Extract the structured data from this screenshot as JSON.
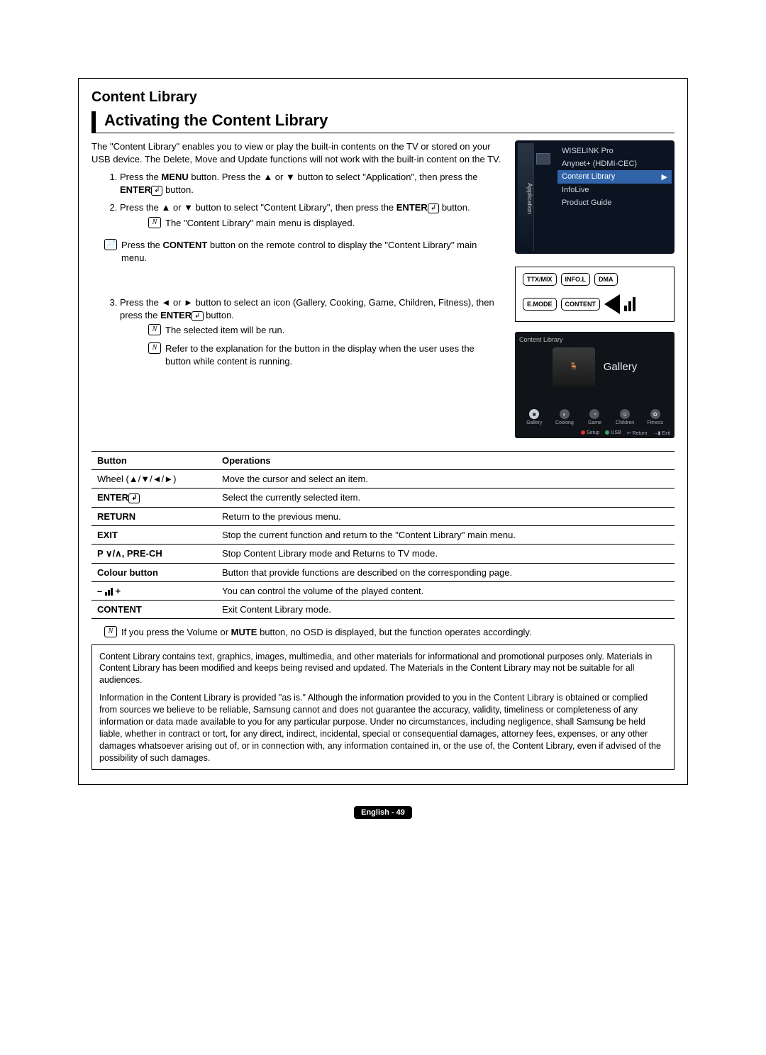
{
  "section_title": "Content Library",
  "subtitle": "Activating the Content Library",
  "intro": "The \"Content Library\" enables you to view or play the built-in contents on the TV or stored on your USB device. The Delete, Move and Update functions will not work with the built-in content on the TV.",
  "steps": {
    "s1_a": "Press the ",
    "s1_menu": "MENU",
    "s1_b": " button. Press the ▲ or ▼ button to select \"Application\", then press the ",
    "s1_enter": "ENTER",
    "s1_c": " button.",
    "s2_a": "Press the ▲ or ▼ button to select \"Content Library\", then press the ",
    "s2_enter": "ENTER",
    "s2_b": " button.",
    "s2_note": "The \"Content Library\" main menu is displayed.",
    "remote_a": "Press the ",
    "remote_content": "CONTENT",
    "remote_b": " button on the remote control to display the \"Content Library\" main menu.",
    "s3_a": "Press the ◄ or ► button to select an icon (Gallery, Cooking, Game, Children, Fitness), then press the ",
    "s3_enter": "ENTER",
    "s3_b": " button.",
    "s3_note1": "The selected item will be run.",
    "s3_note2": "Refer to the explanation for the button in the display when the user uses the button while content is running."
  },
  "tv_menu": {
    "sidebar": "Application",
    "items": [
      "WISELINK Pro",
      "Anynet+ (HDMI-CEC)",
      "Content Library",
      "InfoLive",
      "Product Guide"
    ],
    "arrow": "▶"
  },
  "remote": {
    "b1": "TTX/MIX",
    "b2": "INFO.L",
    "b3": "DMA",
    "b4": "E.MODE",
    "b5": "CONTENT"
  },
  "gallery": {
    "title": "Content Library",
    "selected": "Gallery",
    "icons": [
      "Gallery",
      "Cooking",
      "Game",
      "Children",
      "Fitness"
    ],
    "glyphs": [
      "■",
      "◐",
      "◔",
      "☺",
      "✿"
    ],
    "footer": [
      {
        "color": "#d33",
        "label": "Setup"
      },
      {
        "color": "#3a6",
        "label": "USB"
      },
      {
        "color": "",
        "label": "↩ Return"
      },
      {
        "color": "",
        "label": "→▮ Exit"
      }
    ]
  },
  "table": {
    "h1": "Button",
    "h2": "Operations",
    "rows": [
      {
        "b": "Wheel (▲/▼/◄/►)",
        "bold": false,
        "op": "Move the cursor and select an item."
      },
      {
        "b": "ENTER",
        "bold": true,
        "icon": "enter",
        "op": "Select the currently selected item."
      },
      {
        "b": "RETURN",
        "bold": true,
        "op": "Return to the previous menu."
      },
      {
        "b": "EXIT",
        "bold": true,
        "op": "Stop the current function and return to the \"Content Library\" main menu."
      },
      {
        "b": "P ∨/∧, PRE-CH",
        "bold": true,
        "op": "Stop Content Library mode and Returns to TV mode."
      },
      {
        "b": "Colour button",
        "bold": true,
        "op": "Button that provide functions are described on the corresponding page."
      },
      {
        "b": "vol",
        "bold": true,
        "op": "You can control the volume of the played content."
      },
      {
        "b": "CONTENT",
        "bold": true,
        "op": "Exit Content Library mode."
      }
    ]
  },
  "footnote_a": "If you press the Volume or ",
  "footnote_mute": "MUTE",
  "footnote_b": " button, no OSD is displayed, but the function operates accordingly.",
  "info1": "Content Library contains text, graphics, images, multimedia, and other materials for informational and promotional purposes only. Materials in Content Library has been modified and keeps being revised and updated.  The Materials in the Content Library may not be suitable for all audiences.",
  "info2": "Information in the Content Library is provided \"as is.\" Although the information provided to you in the Content Library is obtained or complied from sources we believe to be reliable, Samsung cannot and does not guarantee the accuracy, validity, timeliness or completeness of any information or data made available to you for any particular purpose. Under no circumstances, including negligence, shall Samsung be held liable, whether in contract or tort, for any direct, indirect, incidental, special or consequential damages, attorney fees, expenses, or any other damages whatsoever arising out of, or in connection with, any information contained in, or the use of, the Content Library, even if advised of the possibility of such damages.",
  "pagefoot": "English - 49",
  "marker_n": "N",
  "marker_remote": "📄",
  "enter_glyph": "↲"
}
